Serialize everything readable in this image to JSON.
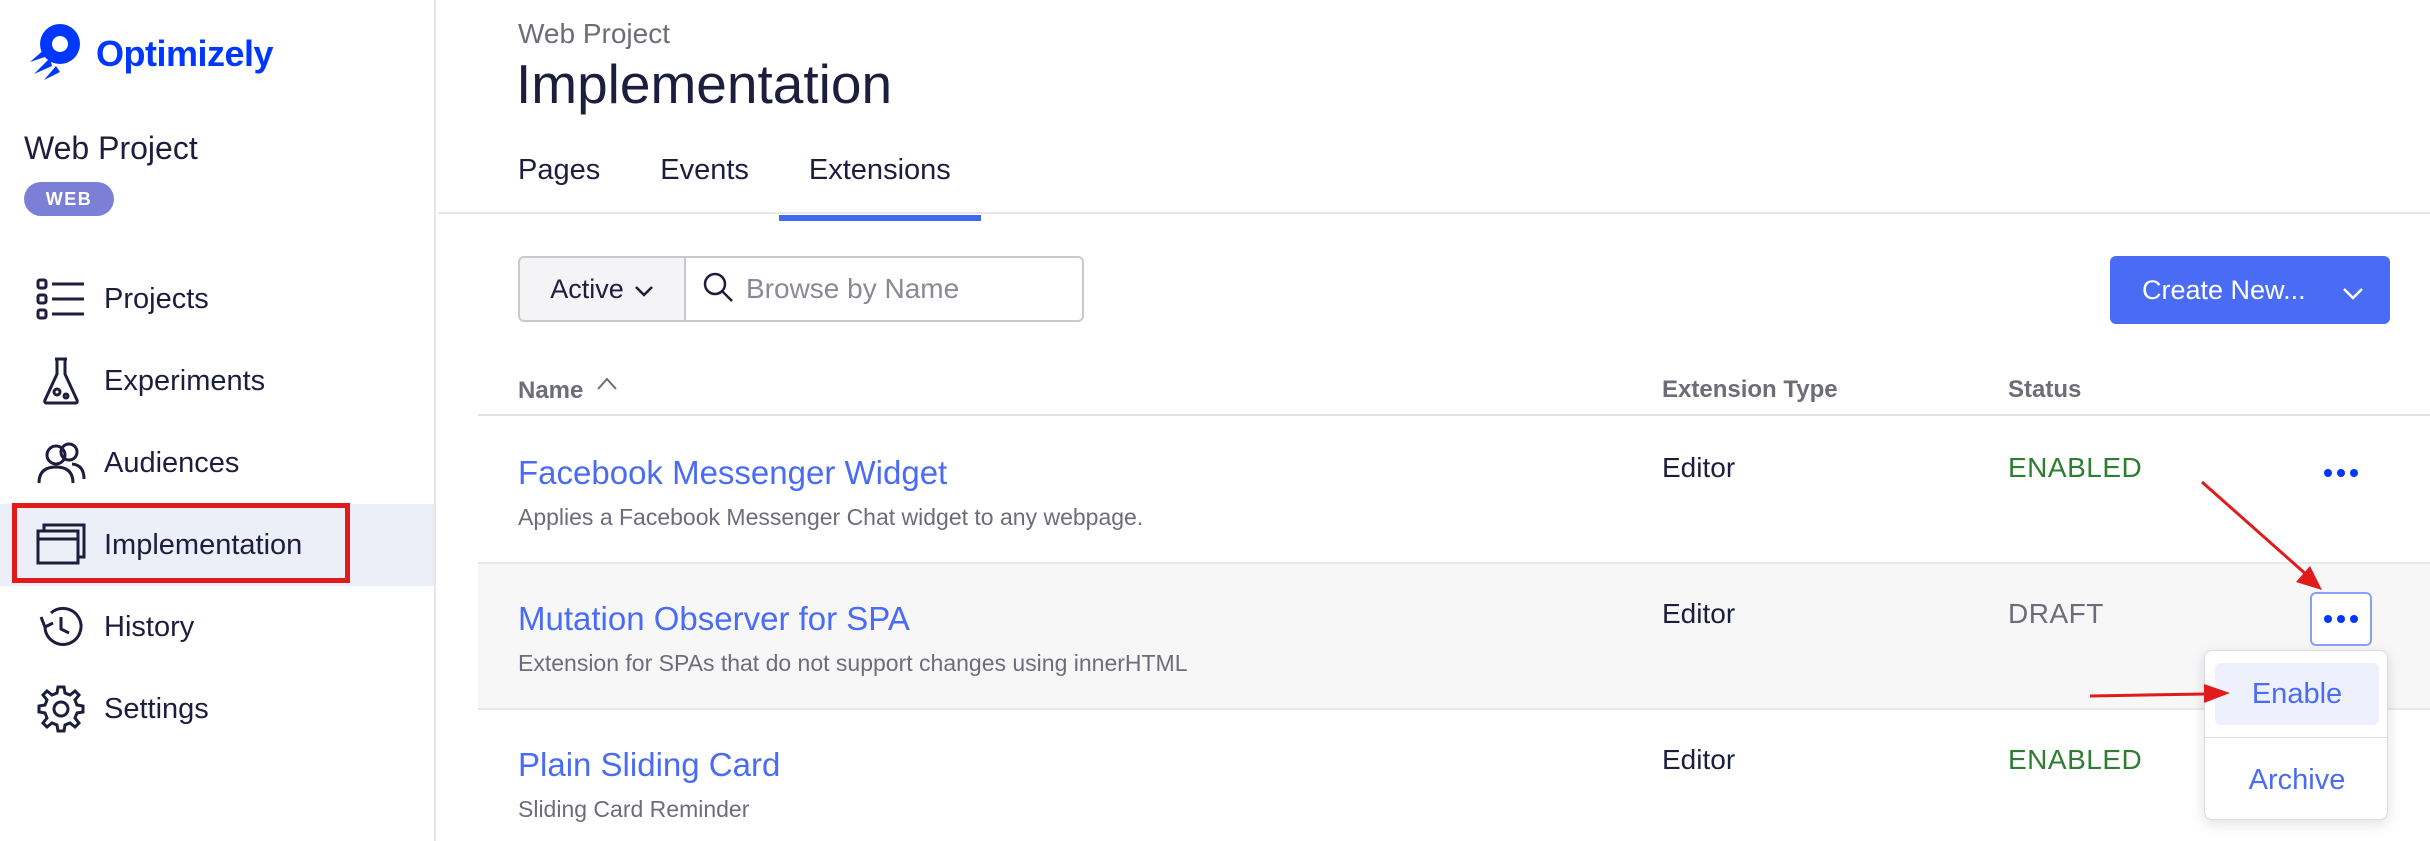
{
  "colors": {
    "brand": "#0037ff",
    "accent": "#4a6cf5",
    "enabled": "#2e7d32",
    "draft": "#6d6d7a",
    "highlight": "#e01b1b",
    "badge": "#7b80d6"
  },
  "sidebar": {
    "logo_text": "Optimizely",
    "project_name": "Web Project",
    "project_badge": "WEB",
    "items": [
      {
        "label": "Projects",
        "icon": "list-icon"
      },
      {
        "label": "Experiments",
        "icon": "flask-icon"
      },
      {
        "label": "Audiences",
        "icon": "people-icon"
      },
      {
        "label": "Implementation",
        "icon": "window-icon",
        "selected": true
      },
      {
        "label": "History",
        "icon": "history-icon"
      },
      {
        "label": "Settings",
        "icon": "gear-icon"
      }
    ]
  },
  "header": {
    "breadcrumb": "Web Project",
    "title": "Implementation"
  },
  "tabs": [
    {
      "label": "Pages"
    },
    {
      "label": "Events"
    },
    {
      "label": "Extensions",
      "active": true
    }
  ],
  "toolbar": {
    "filter_value": "Active",
    "search_placeholder": "Browse by Name",
    "create_label": "Create New..."
  },
  "table": {
    "columns": [
      "Name",
      "Extension Type",
      "Status"
    ],
    "rows": [
      {
        "name": "Facebook Messenger Widget",
        "description": "Applies a Facebook Messenger Chat widget to any webpage.",
        "type": "Editor",
        "status": "ENABLED"
      },
      {
        "name": "Mutation Observer for SPA",
        "description": "Extension for SPAs that do not support changes using innerHTML",
        "type": "Editor",
        "status": "DRAFT"
      },
      {
        "name": "Plain Sliding Card",
        "description": "Sliding Card Reminder",
        "type": "Editor",
        "status": "ENABLED"
      }
    ]
  },
  "row_menu": {
    "items": [
      "Enable",
      "Archive"
    ]
  }
}
